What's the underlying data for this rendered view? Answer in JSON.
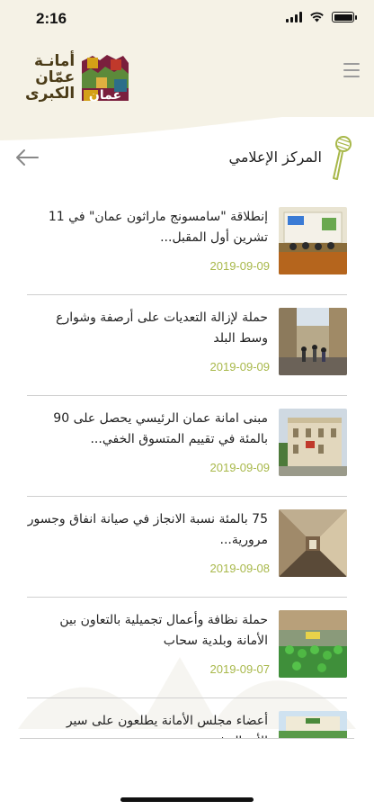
{
  "status": {
    "time": "2:16"
  },
  "header": {
    "logo_line1": "أمانـة",
    "logo_line2": "عمّان",
    "logo_line3": "الكبرى"
  },
  "page": {
    "title": "المركز الإعلامي"
  },
  "news": [
    {
      "title": "إنطلاقة \"سامسونج ماراثون عمان\" في 11 تشرين أول المقبل...",
      "date": "2019-09-09",
      "thumb": "conference-photo"
    },
    {
      "title": "حملة لإزالة التعديات على أرصفة وشوارع وسط البلد",
      "date": "2019-09-09",
      "thumb": "street-photo"
    },
    {
      "title": "مبنى امانة عمان الرئيسي يحصل على 90 بالمئة في تقييم المتسوق الخفي...",
      "date": "2019-09-09",
      "thumb": "building-photo"
    },
    {
      "title": "75 بالمئة نسبة الانجاز في صيانة انفاق وجسور مرورية...",
      "date": "2019-09-08",
      "thumb": "tunnel-photo"
    },
    {
      "title": "حملة نظافة وأعمال تجميلية بالتعاون بين الأمانة وبلدية سحاب",
      "date": "2019-09-07",
      "thumb": "volunteers-photo"
    },
    {
      "title": "أعضاء مجلس الأمانة يطلعون على سير الأعمال في",
      "date": "",
      "thumb": "event-photo"
    }
  ],
  "colors": {
    "header_bg": "#f5f2e6",
    "accent": "#a8b84a",
    "divider": "#cfcfcf"
  }
}
